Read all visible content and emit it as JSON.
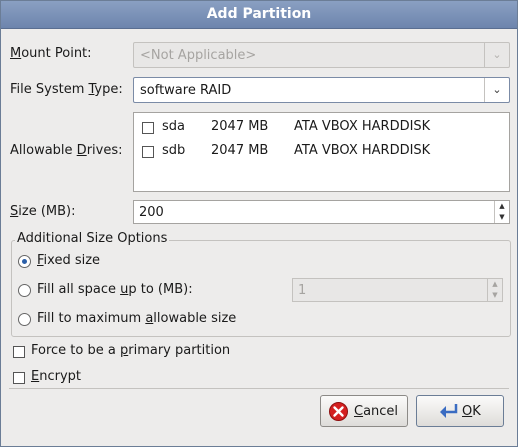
{
  "dialog": {
    "title": "Add Partition"
  },
  "mount_point": {
    "label": "Mount Point:",
    "value": "<Not Applicable>",
    "enabled": false
  },
  "fs_type": {
    "label": "File System Type:",
    "value": "software RAID"
  },
  "drives": {
    "label": "Allowable Drives:",
    "items": [
      {
        "name": "sda",
        "size": "2047 MB",
        "model": "ATA VBOX HARDDISK",
        "checked": false
      },
      {
        "name": "sdb",
        "size": "2047 MB",
        "model": "ATA VBOX HARDDISK",
        "checked": false
      }
    ]
  },
  "size": {
    "label": "Size (MB):",
    "value": "200"
  },
  "additional": {
    "title": "Additional Size Options",
    "fixed": "Fixed size",
    "fill_upto": "Fill all space up to (MB):",
    "fill_upto_value": "1",
    "fill_max": "Fill to maximum allowable size",
    "selected": "fixed"
  },
  "force_primary": {
    "label": "Force to be a primary partition",
    "checked": false
  },
  "encrypt": {
    "label": "Encrypt",
    "checked": false
  },
  "buttons": {
    "cancel": "Cancel",
    "ok": "OK"
  }
}
